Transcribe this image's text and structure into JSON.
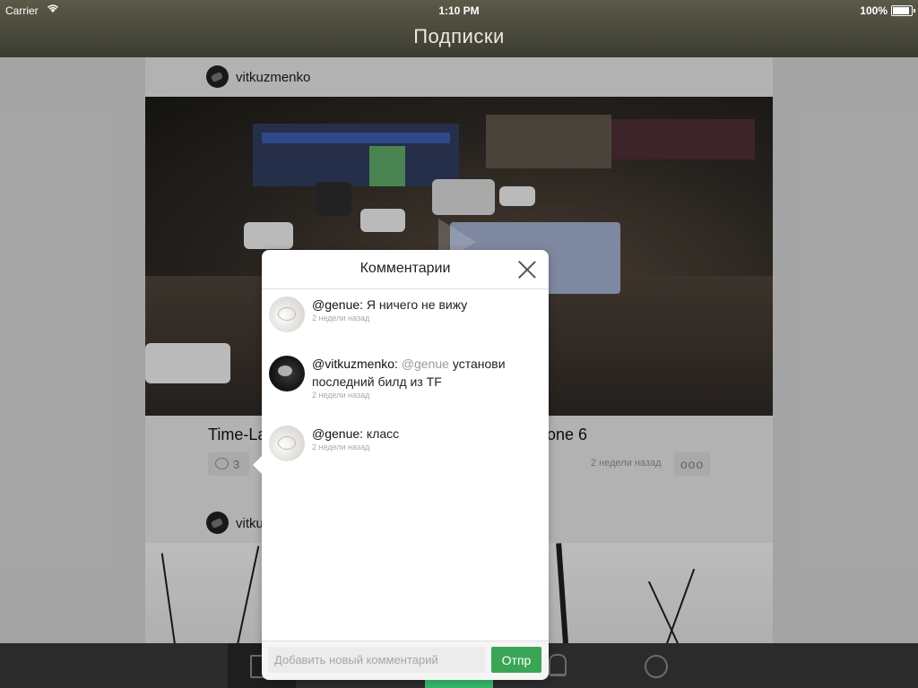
{
  "status_bar": {
    "carrier": "Carrier",
    "time": "1:10 PM",
    "battery": "100%"
  },
  "nav": {
    "title": "Подписки"
  },
  "feed": {
    "post1": {
      "username": "vitkuzmenko",
      "title_left": "Time-La",
      "title_right": "hone 6",
      "comment_count": "3",
      "time_ago": "2 недели назад",
      "more_label": "ooo"
    },
    "post2": {
      "username": "vitku"
    }
  },
  "comments_popover": {
    "title": "Комментарии",
    "comments": [
      {
        "author": "@genue:",
        "text": " Я ничего не вижу",
        "time": "2 недели назад",
        "avatar": "light"
      },
      {
        "author": "@vitkuzmenko:",
        "mention": " @genue",
        "text": " установи последний билд из TF",
        "time": "2 недели назад",
        "avatar": "dark"
      },
      {
        "author": "@genue:",
        "text": " класс",
        "time": "2 недели назад",
        "avatar": "light"
      }
    ],
    "input_placeholder": "Добавить новый комментарий",
    "send_label": "Отпр"
  },
  "colors": {
    "accent_green": "#3aa556",
    "tab_active_green": "#36b76a"
  },
  "tabs": [
    {
      "icon": "feed-icon",
      "active": true
    },
    {
      "icon": "search-icon"
    },
    {
      "icon": "camera-icon"
    },
    {
      "icon": "bell-icon"
    },
    {
      "icon": "profile-icon"
    }
  ]
}
